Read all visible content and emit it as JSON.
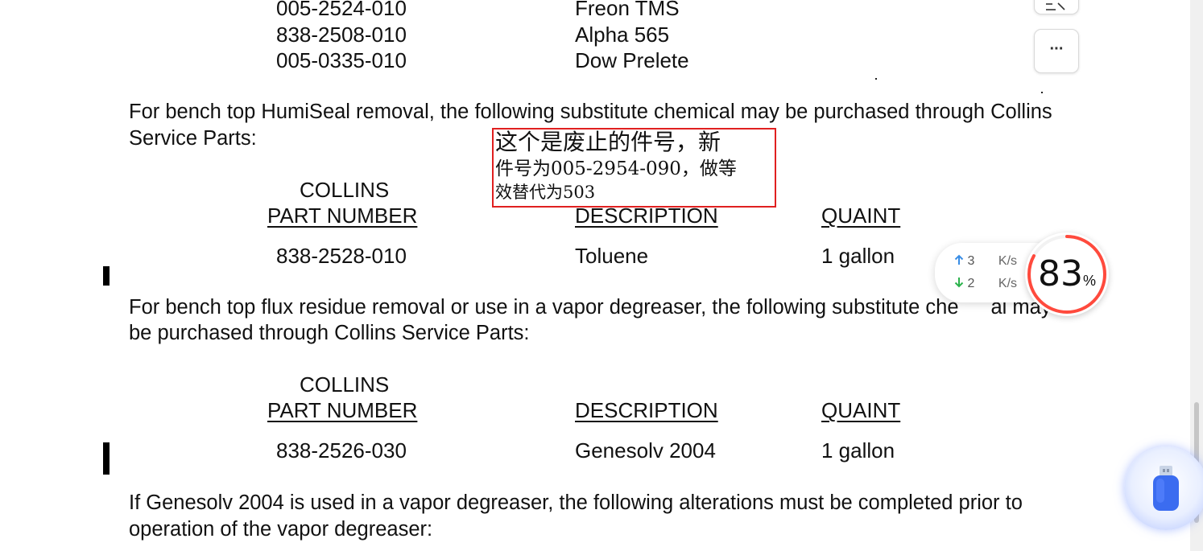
{
  "top_table_rows": [
    {
      "part_number": "005-2524-010",
      "description": "Freon TMS"
    },
    {
      "part_number": "838-2508-010",
      "description": "Alpha 565"
    },
    {
      "part_number": "005-0335-010",
      "description": "Dow Prelete"
    }
  ],
  "paragraph1": {
    "line1": "For bench top HumiSeal removal, the following substitute chemical may be purchased through Collins",
    "line2": "Service Parts:"
  },
  "table1": {
    "header_line1": "COLLINS",
    "header_part_number": "PART NUMBER",
    "header_description": "DESCRIPTION",
    "header_quantity": "QUAINT",
    "row": {
      "part_number": "838-2528-010",
      "description": "Toluene",
      "quantity": "1 gallon"
    }
  },
  "annotation": {
    "line1": "这个是废止的件号，新",
    "line2": "件号为005-2954-090，做等",
    "line3": "效替代为503",
    "border_color": "#e02020"
  },
  "paragraph2": {
    "line1_part1": "For bench top flux residue removal or use in a vapor degreaser, the following subs",
    "line1_part2": "titute che",
    "line1_part3": "al may",
    "line2": "be purchased through Collins Service Parts:"
  },
  "table2": {
    "header_line1": "COLLINS",
    "header_part_number": "PART NUMBER",
    "header_description": "DESCRIPTION",
    "header_quantity": "QUAINT",
    "row": {
      "part_number": "838-2526-030",
      "description": "Genesolv 2004",
      "quantity": "1 gallon"
    }
  },
  "paragraph3": {
    "line1": "If Genesolv 2004 is used in a vapor degreaser, the following alterations must be completed prior to",
    "line2": "operation of the vapor degreaser:"
  },
  "float_buttons": {
    "edit_icon": "edit-icon",
    "more_label": "···"
  },
  "network_monitor": {
    "upload_value": "3",
    "upload_unit": "K/s",
    "download_value": "2",
    "download_unit": "K/s",
    "upload_color": "#3a8ee6",
    "download_color": "#2bb24c"
  },
  "cpu_gauge": {
    "value": "83",
    "unit": "%",
    "fraction": 0.83,
    "accent_color": "#ff4a3d"
  },
  "usb_widget": {
    "icon": "usb-drive-icon",
    "accent_color": "#3b6cf0"
  }
}
